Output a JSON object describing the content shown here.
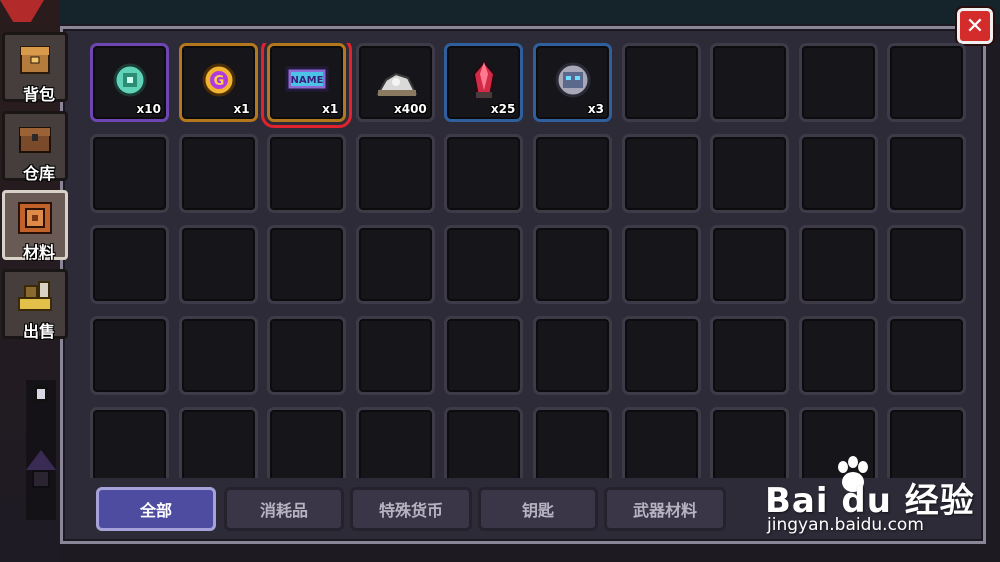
{
  "window": {
    "close_label": "✕"
  },
  "side_tabs": [
    {
      "label": "背包",
      "icon": "backpack-icon",
      "active": false
    },
    {
      "label": "仓库",
      "icon": "warehouse-chest-icon",
      "active": false
    },
    {
      "label": "材料",
      "icon": "materials-box-icon",
      "active": true
    },
    {
      "label": "出售",
      "icon": "sell-goods-icon",
      "active": false
    }
  ],
  "items": [
    {
      "icon": "green-gem-coin-icon",
      "qty": "x10",
      "rarity": "purple",
      "selected": false
    },
    {
      "icon": "gold-g-coin-icon",
      "qty": "x1",
      "rarity": "orange",
      "selected": false
    },
    {
      "icon": "name-card-icon",
      "qty": "x1",
      "rarity": "orange",
      "selected": true
    },
    {
      "icon": "silver-ore-pile-icon",
      "qty": "x400",
      "rarity": "none",
      "selected": false
    },
    {
      "icon": "red-crystal-icon",
      "qty": "x25",
      "rarity": "blue",
      "selected": false
    },
    {
      "icon": "robot-core-icon",
      "qty": "x3",
      "rarity": "blue",
      "selected": false
    }
  ],
  "categories": [
    {
      "label": "全部",
      "active": true
    },
    {
      "label": "消耗品",
      "active": false
    },
    {
      "label": "特殊货币",
      "active": false
    },
    {
      "label": "钥匙",
      "active": false
    },
    {
      "label": "武器材料",
      "active": false
    }
  ],
  "watermark": {
    "brand": "Bai du 经验",
    "url": "jingyan.baidu.com"
  },
  "colors": {
    "panel_bg": "#2e2b38",
    "selected_outline": "#e0232f",
    "active_category": "#4e4ca0",
    "close_button": "#d42b2b"
  }
}
